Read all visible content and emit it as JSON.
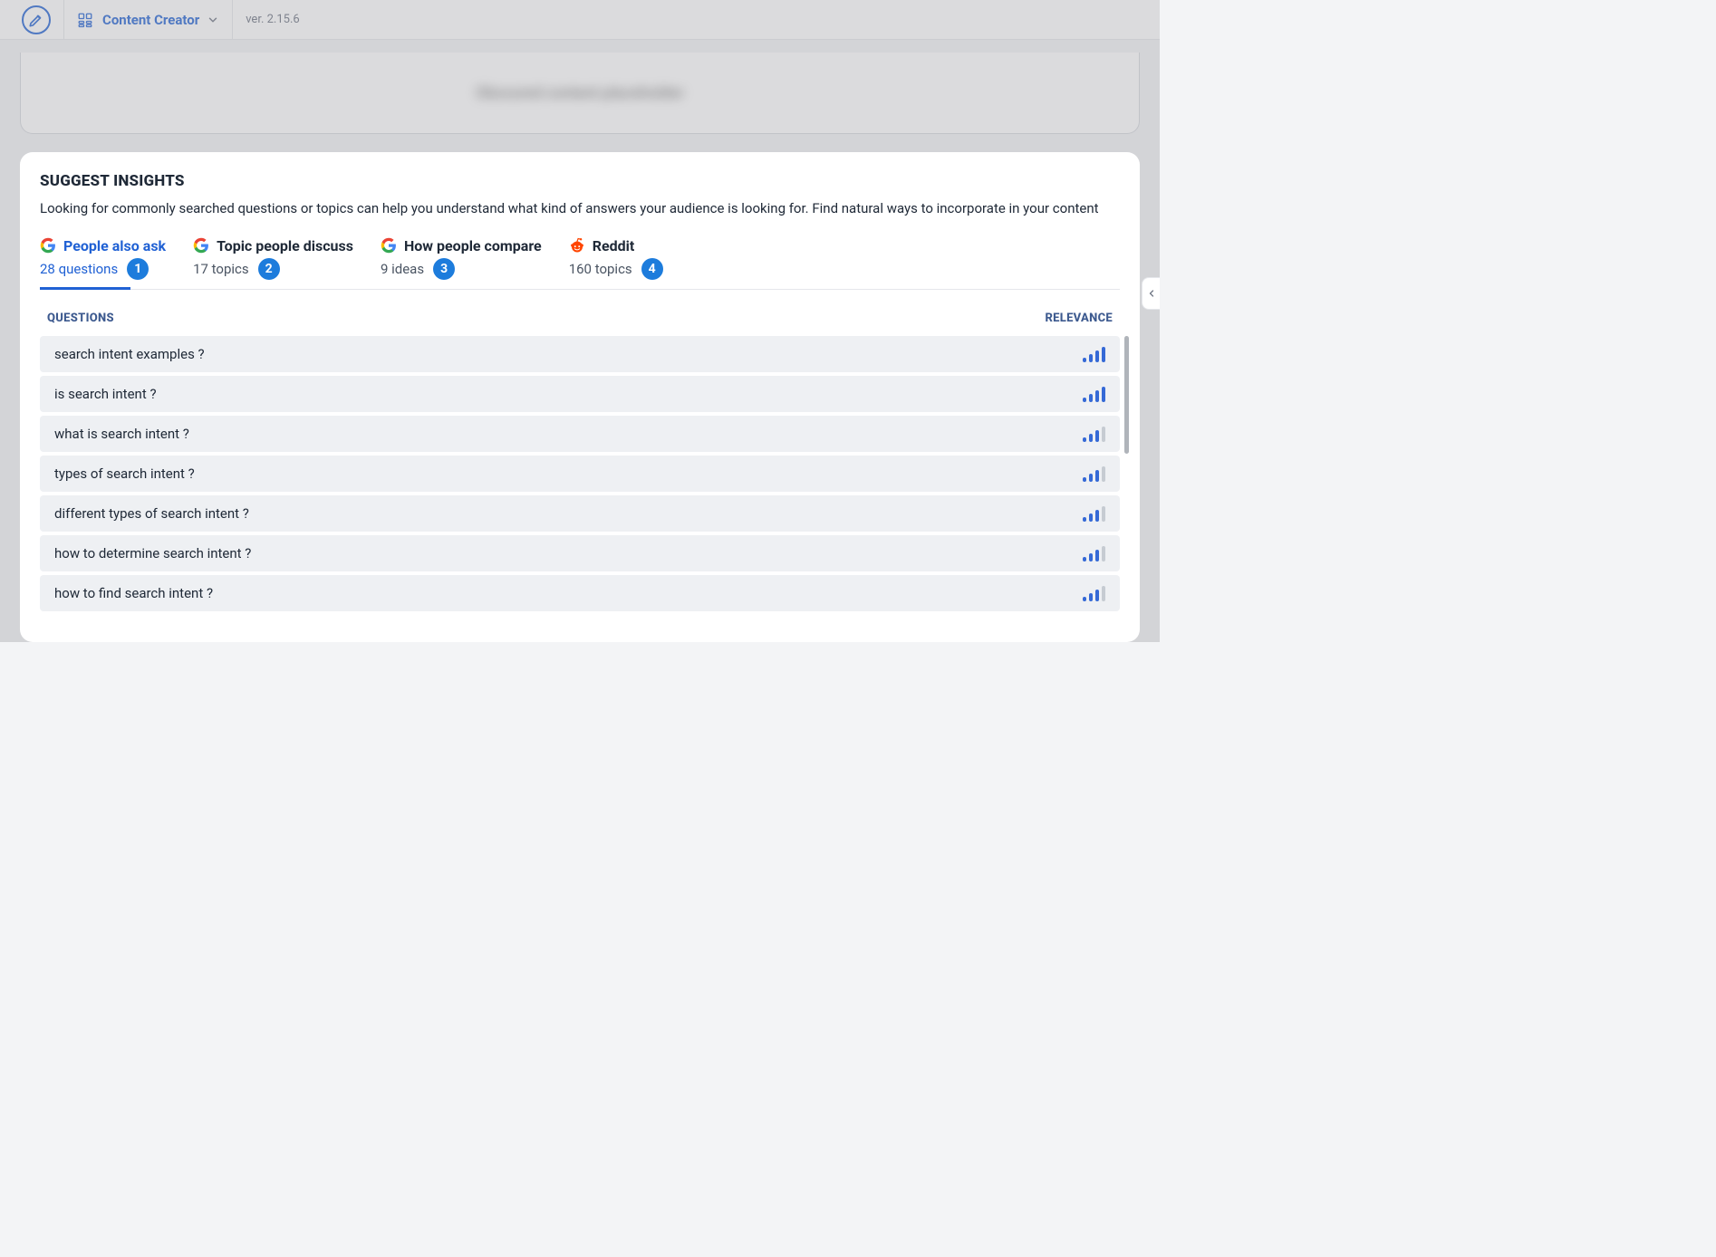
{
  "header": {
    "title": "Content Creator",
    "version": "ver. 2.15.6"
  },
  "top_card": {
    "obscured_text": "Obscured content placeholder"
  },
  "panel": {
    "title": "SUGGEST INSIGHTS",
    "description": "Looking for commonly searched questions or topics can help you understand what kind of answers your audience is looking for. Find natural ways to incorporate in your content",
    "tabs": [
      {
        "source": "google",
        "label": "People also ask",
        "count": "28 questions",
        "badge": "1",
        "active": true
      },
      {
        "source": "google",
        "label": "Topic people discuss",
        "count": "17 topics",
        "badge": "2",
        "active": false
      },
      {
        "source": "google",
        "label": "How people compare",
        "count": "9 ideas",
        "badge": "3",
        "active": false
      },
      {
        "source": "reddit",
        "label": "Reddit",
        "count": "160 topics",
        "badge": "4",
        "active": false
      }
    ],
    "columns": {
      "left": "QUESTIONS",
      "right": "RELEVANCE"
    },
    "rows": [
      {
        "q": "search intent examples ?",
        "relevance": 4
      },
      {
        "q": "is search intent ?",
        "relevance": 4
      },
      {
        "q": "what is search intent ?",
        "relevance": 3
      },
      {
        "q": "types of search intent ?",
        "relevance": 3
      },
      {
        "q": "different types of search intent ?",
        "relevance": 3
      },
      {
        "q": "how to determine search intent ?",
        "relevance": 3
      },
      {
        "q": "how to find search intent ?",
        "relevance": 3
      }
    ]
  }
}
